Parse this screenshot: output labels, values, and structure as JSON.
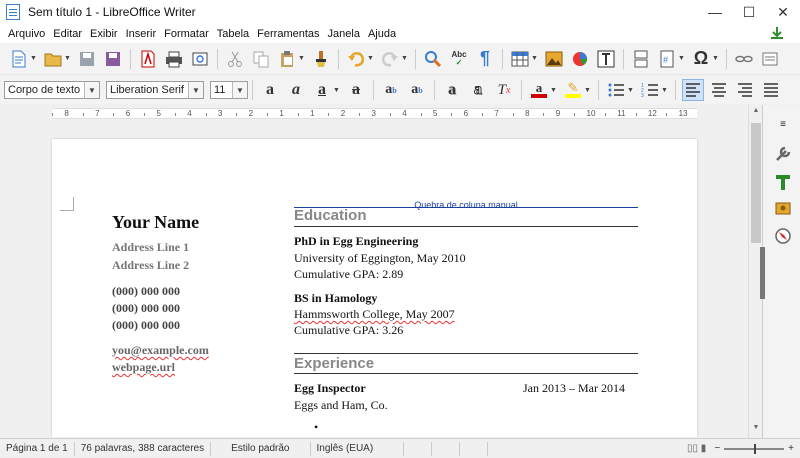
{
  "window": {
    "title": "Sem título 1 - LibreOffice Writer",
    "controls": [
      "—",
      "☐",
      "✕"
    ]
  },
  "menu": [
    "Arquivo",
    "Editar",
    "Exibir",
    "Inserir",
    "Formatar",
    "Tabela",
    "Ferramentas",
    "Janela",
    "Ajuda"
  ],
  "formatting": {
    "paragraph_style": "Corpo de texto",
    "font_name": "Liberation Serif",
    "font_size": "11"
  },
  "ruler": {
    "labels": [
      "8",
      "7",
      "6",
      "5",
      "4",
      "3",
      "2",
      "1",
      "1",
      "2",
      "3",
      "4",
      "5",
      "6",
      "7",
      "8",
      "9",
      "10",
      "11",
      "12",
      "13"
    ]
  },
  "document": {
    "page_break_label": "Quebra de coluna manual",
    "left": {
      "name": "Your Name",
      "address1": "Address Line 1",
      "address2": "Address Line 2",
      "phone1": "(000) 000 000",
      "phone2": "(000) 000 000",
      "phone3": "(000) 000 000",
      "email": "you@example.com",
      "web": "webpage.url"
    },
    "education": {
      "title": "Education",
      "entries": [
        {
          "degree": "PhD in Egg Engineering",
          "school": "University of Eggington, May 2010",
          "gpa": "Cumulative GPA: 2.89"
        },
        {
          "degree": "BS in Hamology",
          "school": "Hammsworth College, May 2007",
          "gpa": "Cumulative GPA: 3.26"
        }
      ]
    },
    "experience": {
      "title": "Experience",
      "job_title": "Egg Inspector",
      "dates": "Jan 2013 – Mar 2014",
      "company": "Eggs and Ham, Co.",
      "bullet": "•"
    }
  },
  "status": {
    "page": "Página 1 de 1",
    "words": "76 palavras, 388 caracteres",
    "style": "Estilo padrão",
    "language": "Inglês (EUA)",
    "zoom_minus": "−",
    "zoom_plus": "+"
  },
  "colors": {
    "accent": "#1a3fa0",
    "section_gray": "#888888",
    "spell_red": "#e33333"
  }
}
